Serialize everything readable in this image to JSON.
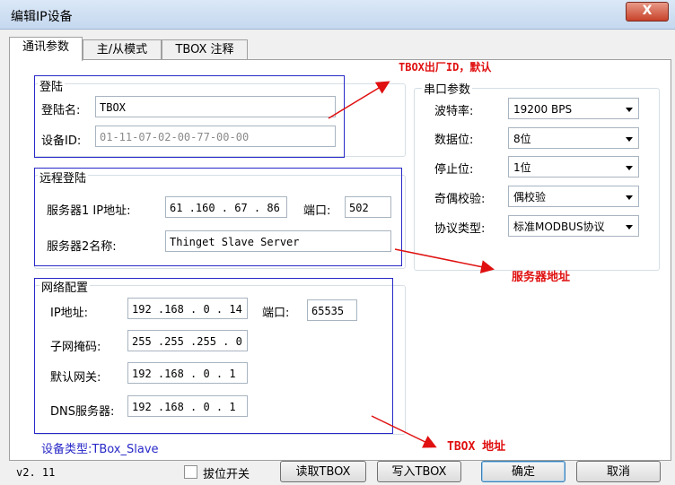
{
  "window": {
    "title": "编辑IP设备",
    "close": "X"
  },
  "tabs": [
    {
      "label": "通讯参数"
    },
    {
      "label": "主/从模式"
    },
    {
      "label": "TBOX 注释"
    }
  ],
  "login": {
    "group": "登陆",
    "name_label": "登陆名:",
    "name_value": "TBOX",
    "id_label": "设备ID:",
    "id_value": "01-11-07-02-00-77-00-00"
  },
  "remote": {
    "group": "远程登陆",
    "server1_label": "服务器1 IP地址:",
    "server1_ip": "61 .160 . 67 . 86",
    "port_label": "端口:",
    "port_value": "502",
    "server2_label": "服务器2名称:",
    "server2_value": "Thinget Slave Server"
  },
  "network": {
    "group": "网络配置",
    "ip_label": "IP地址:",
    "ip_value": "192 .168 . 0 . 14",
    "port_label": "端口:",
    "port_value": "65535",
    "mask_label": "子网掩码:",
    "mask_value": "255 .255 .255 . 0",
    "gateway_label": "默认网关:",
    "gateway_value": "192 .168 . 0 . 1",
    "dns_label": "DNS服务器:",
    "dns_value": "192 .168 . 0 . 1"
  },
  "serial": {
    "group": "串口参数",
    "baud_label": "波特率:",
    "baud_value": "19200 BPS",
    "data_label": "数据位:",
    "data_value": "8位",
    "stop_label": "停止位:",
    "stop_value": "1位",
    "parity_label": "奇偶校验:",
    "parity_value": "偶校验",
    "protocol_label": "协议类型:",
    "protocol_value": "标准MODBUS协议"
  },
  "device_type": "设备类型:TBox_Slave",
  "annotations": {
    "a1": "TBOX出厂ID，默认",
    "a2": "服务器地址",
    "a3": "TBOX 地址"
  },
  "footer": {
    "version": "v2. 11",
    "dip_label": "拔位开关",
    "read_button": "读取TBOX",
    "write_button": "写入TBOX",
    "ok_button": "确定",
    "cancel_button": "取消"
  },
  "colors": {
    "annotation": "#e01010",
    "highlight_box": "#2828c8",
    "device_type": "#2828c8"
  }
}
